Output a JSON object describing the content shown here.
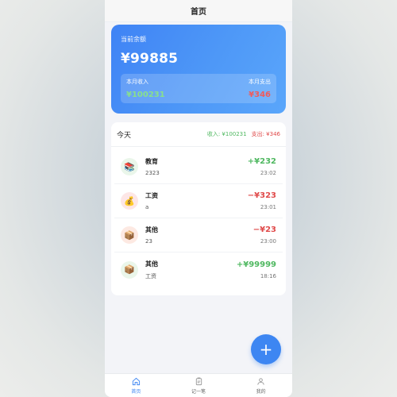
{
  "navbar": {
    "title": "首页"
  },
  "balance": {
    "label": "当前余额",
    "value": "¥99885",
    "month_income_label": "本月收入",
    "month_income_value": "¥100231",
    "month_expense_label": "本月支出",
    "month_expense_value": "¥346"
  },
  "today": {
    "title": "今天",
    "income_summary": "收入: ¥100231",
    "expense_summary": "支出: ¥346",
    "records": [
      {
        "icon": "books-icon",
        "category": "教育",
        "note": "2323",
        "amount": "+¥232",
        "type": "income",
        "time": "23:02"
      },
      {
        "icon": "money-bag-icon",
        "category": "工资",
        "note": "a",
        "amount": "−¥323",
        "type": "expense",
        "time": "23:01"
      },
      {
        "icon": "package-icon",
        "category": "其他",
        "note": "23",
        "amount": "−¥23",
        "type": "expense",
        "time": "23:00"
      },
      {
        "icon": "package-icon",
        "category": "其他",
        "note": "工资",
        "amount": "+¥99999",
        "type": "income",
        "time": "18:16"
      }
    ]
  },
  "fab": {
    "label": "+"
  },
  "tabbar": {
    "items": [
      {
        "label": "首页",
        "icon": "home-icon",
        "active": true
      },
      {
        "label": "记一笔",
        "icon": "clipboard-icon",
        "active": false
      },
      {
        "label": "我的",
        "icon": "user-icon",
        "active": false
      }
    ]
  },
  "colors": {
    "accent": "#3d86f2",
    "income": "#4fb860",
    "expense": "#e04a4a"
  }
}
